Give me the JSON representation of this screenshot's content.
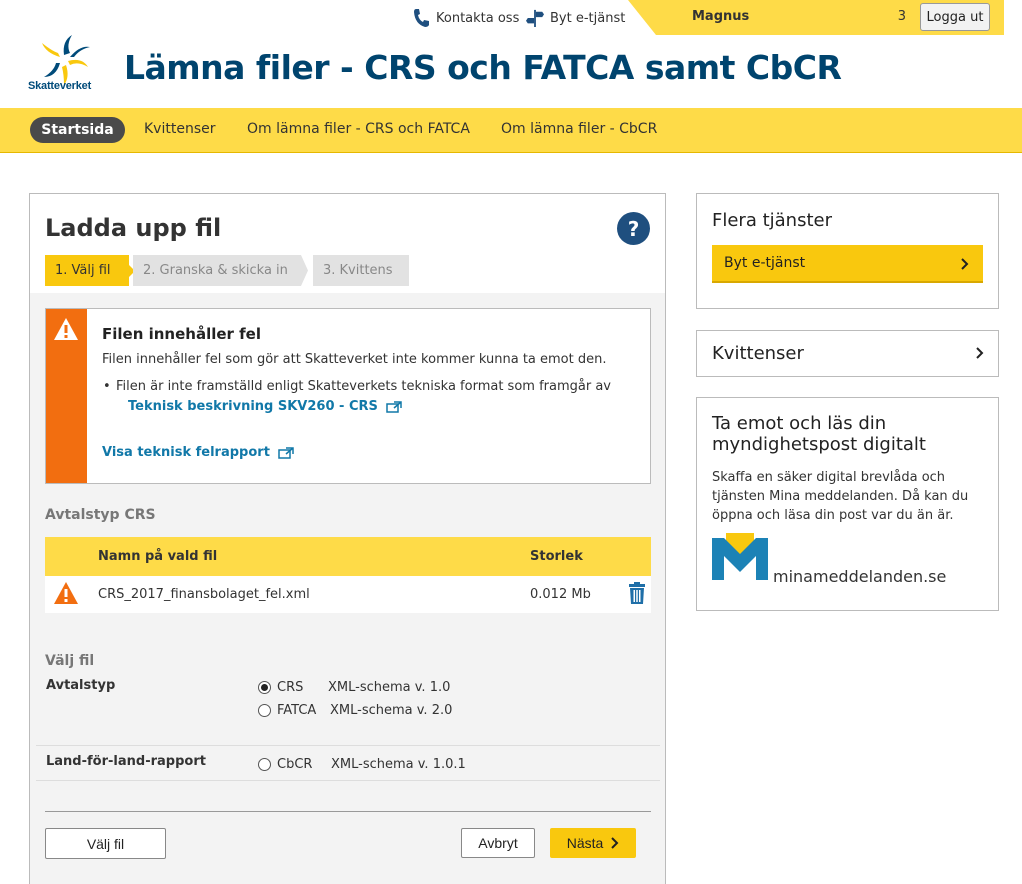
{
  "topbar": {
    "contact": "Kontakta oss",
    "switch_service": "Byt e-tjänst",
    "user_name": "Magnus",
    "user_fragment": "3",
    "logout": "Logga ut"
  },
  "header": {
    "logo_text": "Skatteverket",
    "title": "Lämna filer - CRS och FATCA samt CbCR"
  },
  "nav": {
    "items": [
      "Startsida",
      "Kvittenser",
      "Om lämna filer - CRS och FATCA",
      "Om lämna filer - CbCR"
    ]
  },
  "main": {
    "title": "Ladda upp fil",
    "help": "?",
    "steps": [
      "1. Välj fil",
      "2. Granska & skicka in",
      "3. Kvittens"
    ],
    "error": {
      "title": "Filen innehåller fel",
      "text": "Filen innehåller fel som gör att Skatteverket inte kommer kunna ta emot den.",
      "bullet": "Filen är inte framställd enligt Skatteverkets tekniska format som framgår av",
      "link1": "Teknisk beskrivning SKV260 - CRS",
      "link2": "Visa teknisk felrapport"
    },
    "agreement_label": "Avtalstyp CRS",
    "table": {
      "headers": [
        "Namn på vald fil",
        "Storlek"
      ],
      "rows": [
        {
          "name": "CRS_2017_finansbolaget_fel.xml",
          "size": "0.012 Mb"
        }
      ]
    },
    "choose_section": "Välj fil",
    "avtalstyp_label": "Avtalstyp",
    "options": [
      {
        "name": "CRS",
        "schema": "XML-schema v. 1.0",
        "checked": true
      },
      {
        "name": "FATCA",
        "schema": "XML-schema v. 2.0",
        "checked": false
      }
    ],
    "country_label": "Land-för-land-rapport",
    "cbcr_option": {
      "name": "CbCR",
      "schema": "XML-schema v. 1.0.1",
      "checked": false
    },
    "buttons": {
      "choose": "Välj fil",
      "cancel": "Avbryt",
      "next": "Nästa"
    }
  },
  "sidebar": {
    "more_services": {
      "title": "Flera tjänster",
      "button": "Byt e-tjänst"
    },
    "receipts": {
      "title": "Kvittenser"
    },
    "digital_post": {
      "title": "Ta emot och läs din myndighetspost digitalt",
      "text": "Skaffa en säker digital brevlåda och tjänsten Mina meddelanden. Då kan du öppna och läsa din post var du än är.",
      "logo_text": "minameddelanden.se"
    }
  },
  "colors": {
    "brand_yellow": "#fedb48",
    "brand_blue": "#00446e",
    "warning_orange": "#f26e10",
    "link_blue": "#1178a8"
  }
}
